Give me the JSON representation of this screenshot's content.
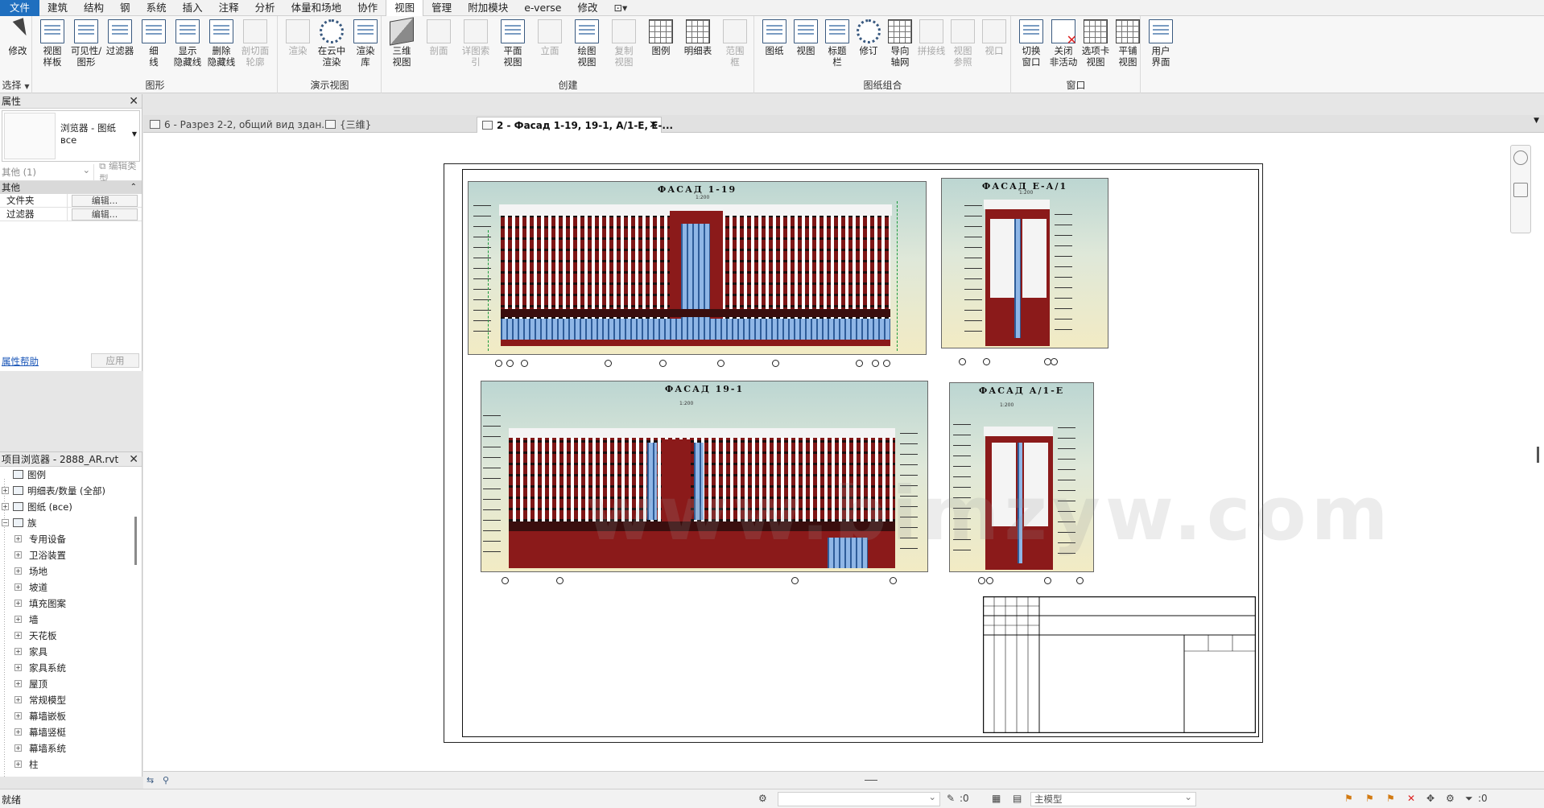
{
  "menu": {
    "items": [
      "文件",
      "建筑",
      "结构",
      "钢",
      "系统",
      "插入",
      "注释",
      "分析",
      "体量和场地",
      "协作",
      "视图",
      "管理",
      "附加模块",
      "e-verse",
      "修改"
    ],
    "active": "视图",
    "extra_icon": "ribbon-toggle-icon"
  },
  "ribbon": {
    "groups": {
      "select": {
        "label": "选择",
        "buttons": [
          {
            "label": "修改",
            "icon": "cursor-icon"
          }
        ]
      },
      "graphics": {
        "label": "图形",
        "buttons": [
          {
            "label": "视图\n样板",
            "icon": "view-template-icon"
          },
          {
            "label": "可见性/\n图形",
            "icon": "visibility-icon"
          },
          {
            "label": "过滤器",
            "icon": "filter-icon"
          },
          {
            "label": "细\n线",
            "icon": "thin-lines-icon"
          },
          {
            "label": "显示\n隐藏线",
            "icon": "show-hidden-icon"
          },
          {
            "label": "删除\n隐藏线",
            "icon": "remove-hidden-icon"
          },
          {
            "label": "剖切面\n轮廓",
            "icon": "cut-profile-icon",
            "disabled": true
          }
        ]
      },
      "presentation": {
        "label": "演示视图",
        "buttons": [
          {
            "label": "渲染",
            "icon": "render-icon",
            "disabled": true
          },
          {
            "label": "在云中\n渲染",
            "icon": "cloud-render-icon"
          },
          {
            "label": "渲染\n库",
            "icon": "render-gallery-icon"
          }
        ]
      },
      "create": {
        "label": "创建",
        "buttons": [
          {
            "label": "三维\n视图",
            "icon": "3d-view-icon"
          },
          {
            "label": "剖面",
            "icon": "section-icon",
            "disabled": true
          },
          {
            "label": "详图索引",
            "icon": "callout-icon",
            "disabled": true
          },
          {
            "label": "平面\n视图",
            "icon": "plan-view-icon"
          },
          {
            "label": "立面",
            "icon": "elevation-icon",
            "disabled": true
          },
          {
            "label": "绘图\n视图",
            "icon": "drafting-view-icon"
          },
          {
            "label": "复制\n视图",
            "icon": "duplicate-view-icon",
            "disabled": true
          },
          {
            "label": "图例",
            "icon": "legend-icon"
          },
          {
            "label": "明细表",
            "icon": "schedule-icon"
          },
          {
            "label": "范围\n框",
            "icon": "scope-box-icon",
            "disabled": true
          }
        ]
      },
      "sheet": {
        "label": "图纸组合",
        "buttons": [
          {
            "label": "图纸",
            "icon": "sheet-icon"
          },
          {
            "label": "视图",
            "icon": "place-view-icon"
          },
          {
            "label": "标题\n栏",
            "icon": "title-block-icon"
          },
          {
            "label": "修订",
            "icon": "revision-icon"
          },
          {
            "label": "导向\n轴网",
            "icon": "guide-grid-icon"
          },
          {
            "label": "拼接线",
            "icon": "matchline-icon",
            "disabled": true
          },
          {
            "label": "视图\n参照",
            "icon": "view-reference-icon",
            "disabled": true
          },
          {
            "label": "视口",
            "icon": "viewports-icon",
            "disabled": true
          }
        ]
      },
      "window": {
        "label": "窗口",
        "buttons": [
          {
            "label": "切换\n窗口",
            "icon": "switch-window-icon"
          },
          {
            "label": "关闭\n非活动",
            "icon": "close-inactive-icon"
          },
          {
            "label": "选项卡\n视图",
            "icon": "tab-views-icon"
          },
          {
            "label": "平铺\n视图",
            "icon": "tile-views-icon"
          }
        ]
      },
      "ui": {
        "label": "",
        "buttons": [
          {
            "label": "用户\n界面",
            "icon": "user-interface-icon"
          }
        ]
      }
    }
  },
  "properties": {
    "title": "属性",
    "type_name": "浏览器 - 图纸",
    "type_sub": "всe",
    "instance_selector": "其他 (1)",
    "edit_type": "编辑类型",
    "category": "其他",
    "rows": [
      {
        "name": "文件夹",
        "value": "编辑..."
      },
      {
        "name": "过滤器",
        "value": "编辑..."
      }
    ],
    "help": "属性帮助",
    "apply": "应用"
  },
  "browser": {
    "title": "项目浏览器 - 2888_AR.rvt",
    "items": [
      {
        "label": "图例",
        "level": 0,
        "expander": "",
        "icon": "legend-icon"
      },
      {
        "label": "明细表/数量 (全部)",
        "level": 0,
        "expander": "+",
        "icon": "schedule-icon"
      },
      {
        "label": "图纸 (всe)",
        "level": 0,
        "expander": "+",
        "icon": "sheet-icon"
      },
      {
        "label": "族",
        "level": 0,
        "expander": "−",
        "icon": "family-icon"
      },
      {
        "label": "专用设备",
        "level": 1,
        "expander": "+"
      },
      {
        "label": "卫浴装置",
        "level": 1,
        "expander": "+"
      },
      {
        "label": "场地",
        "level": 1,
        "expander": "+"
      },
      {
        "label": "坡道",
        "level": 1,
        "expander": "+"
      },
      {
        "label": "填充图案",
        "level": 1,
        "expander": "+"
      },
      {
        "label": "墙",
        "level": 1,
        "expander": "+"
      },
      {
        "label": "天花板",
        "level": 1,
        "expander": "+"
      },
      {
        "label": "家具",
        "level": 1,
        "expander": "+"
      },
      {
        "label": "家具系统",
        "level": 1,
        "expander": "+"
      },
      {
        "label": "屋顶",
        "level": 1,
        "expander": "+"
      },
      {
        "label": "常规模型",
        "level": 1,
        "expander": "+"
      },
      {
        "label": "幕墙嵌板",
        "level": 1,
        "expander": "+"
      },
      {
        "label": "幕墙竖梃",
        "level": 1,
        "expander": "+"
      },
      {
        "label": "幕墙系统",
        "level": 1,
        "expander": "+"
      },
      {
        "label": "柱",
        "level": 1,
        "expander": "+"
      }
    ]
  },
  "tabs": [
    {
      "label": "6 - Разрез 2-2, общий вид здан...",
      "active": false
    },
    {
      "label": "{三维}",
      "active": false
    },
    {
      "label": "2 - Фасад 1-19, 19-1, А/1-Е, Е-...",
      "active": true
    }
  ],
  "sheet": {
    "viewports": [
      {
        "title": "ФАСАД 1-19",
        "scale": "1:200"
      },
      {
        "title": "ФАСАД Е-А/1",
        "scale": "1:200"
      },
      {
        "title": "ФАСАД 19-1",
        "scale": "1:200"
      },
      {
        "title": "ФАСАД А/1-Е",
        "scale": "1:200"
      }
    ],
    "watermark": "www.bimzyw.com"
  },
  "status": {
    "text": "就绪",
    "coord_value": ":0",
    "model": "主模型",
    "filter_count": ":0"
  }
}
